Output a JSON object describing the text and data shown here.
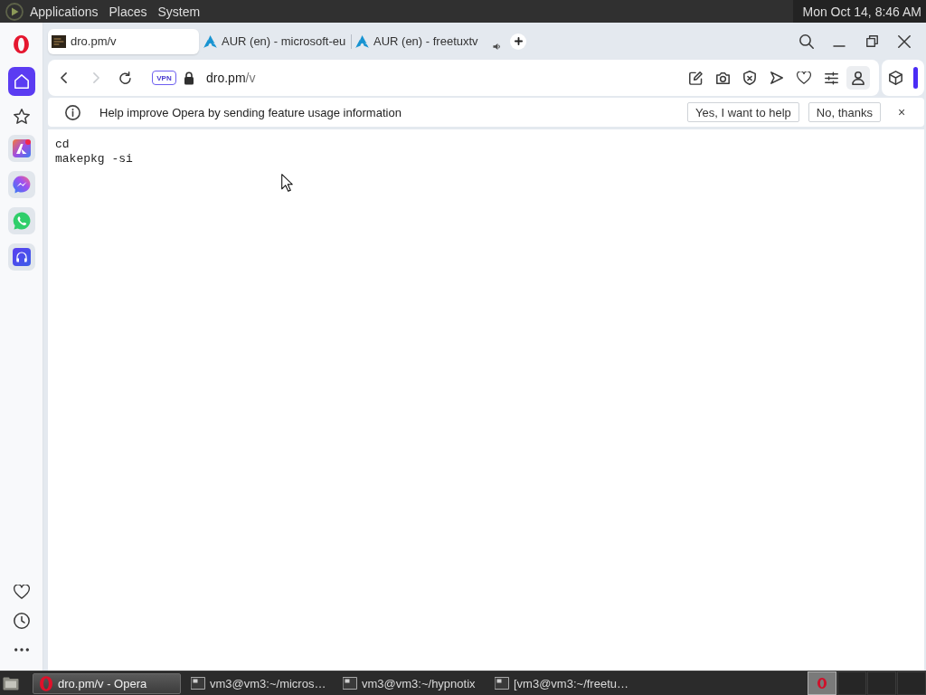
{
  "top_panel": {
    "menus": [
      "Applications",
      "Places",
      "System"
    ],
    "clock": "Mon Oct 14, 8:46 AM"
  },
  "sidebar": {
    "nav": [
      {
        "kind": "home",
        "selected": true
      },
      {
        "kind": "bookmarks",
        "selected": false
      }
    ]
  },
  "tabs": [
    {
      "kind": "square",
      "title": "dro.pm/v",
      "selected": true,
      "audio": false
    },
    {
      "kind": "peak",
      "title": "AUR (en) - microsoft-eu",
      "selected": false,
      "audio": false
    },
    {
      "kind": "peak",
      "title": "AUR (en) - freetuxtv",
      "selected": false,
      "audio": true
    }
  ],
  "address_bar": {
    "back": {
      "disabled": false
    },
    "forward": {
      "disabled": true
    },
    "vpn_badge": "VPN",
    "url": {
      "host": "dro.pm",
      "path": "/v"
    }
  },
  "info_bar": {
    "message": "Help improve Opera by sending feature usage information",
    "buttons": [
      "Yes, I want to help",
      "No, thanks"
    ],
    "close": "×"
  },
  "page": {
    "lines": [
      "cd",
      "makepkg -si"
    ]
  },
  "taskbar": {
    "windows": [
      {
        "kind": "browser",
        "title": "dro.pm/v - Opera",
        "selected": true
      },
      {
        "kind": "terminal",
        "title": "vm3@vm3:~/micros…",
        "selected": false
      },
      {
        "kind": "terminal",
        "title": "vm3@vm3:~/hypnotix",
        "selected": false
      },
      {
        "kind": "terminal",
        "title": "[vm3@vm3:~/freetu…",
        "selected": false
      }
    ],
    "workspaces": [
      {
        "selected": true
      },
      {
        "selected": false
      },
      {
        "selected": false
      },
      {
        "selected": false
      }
    ]
  }
}
